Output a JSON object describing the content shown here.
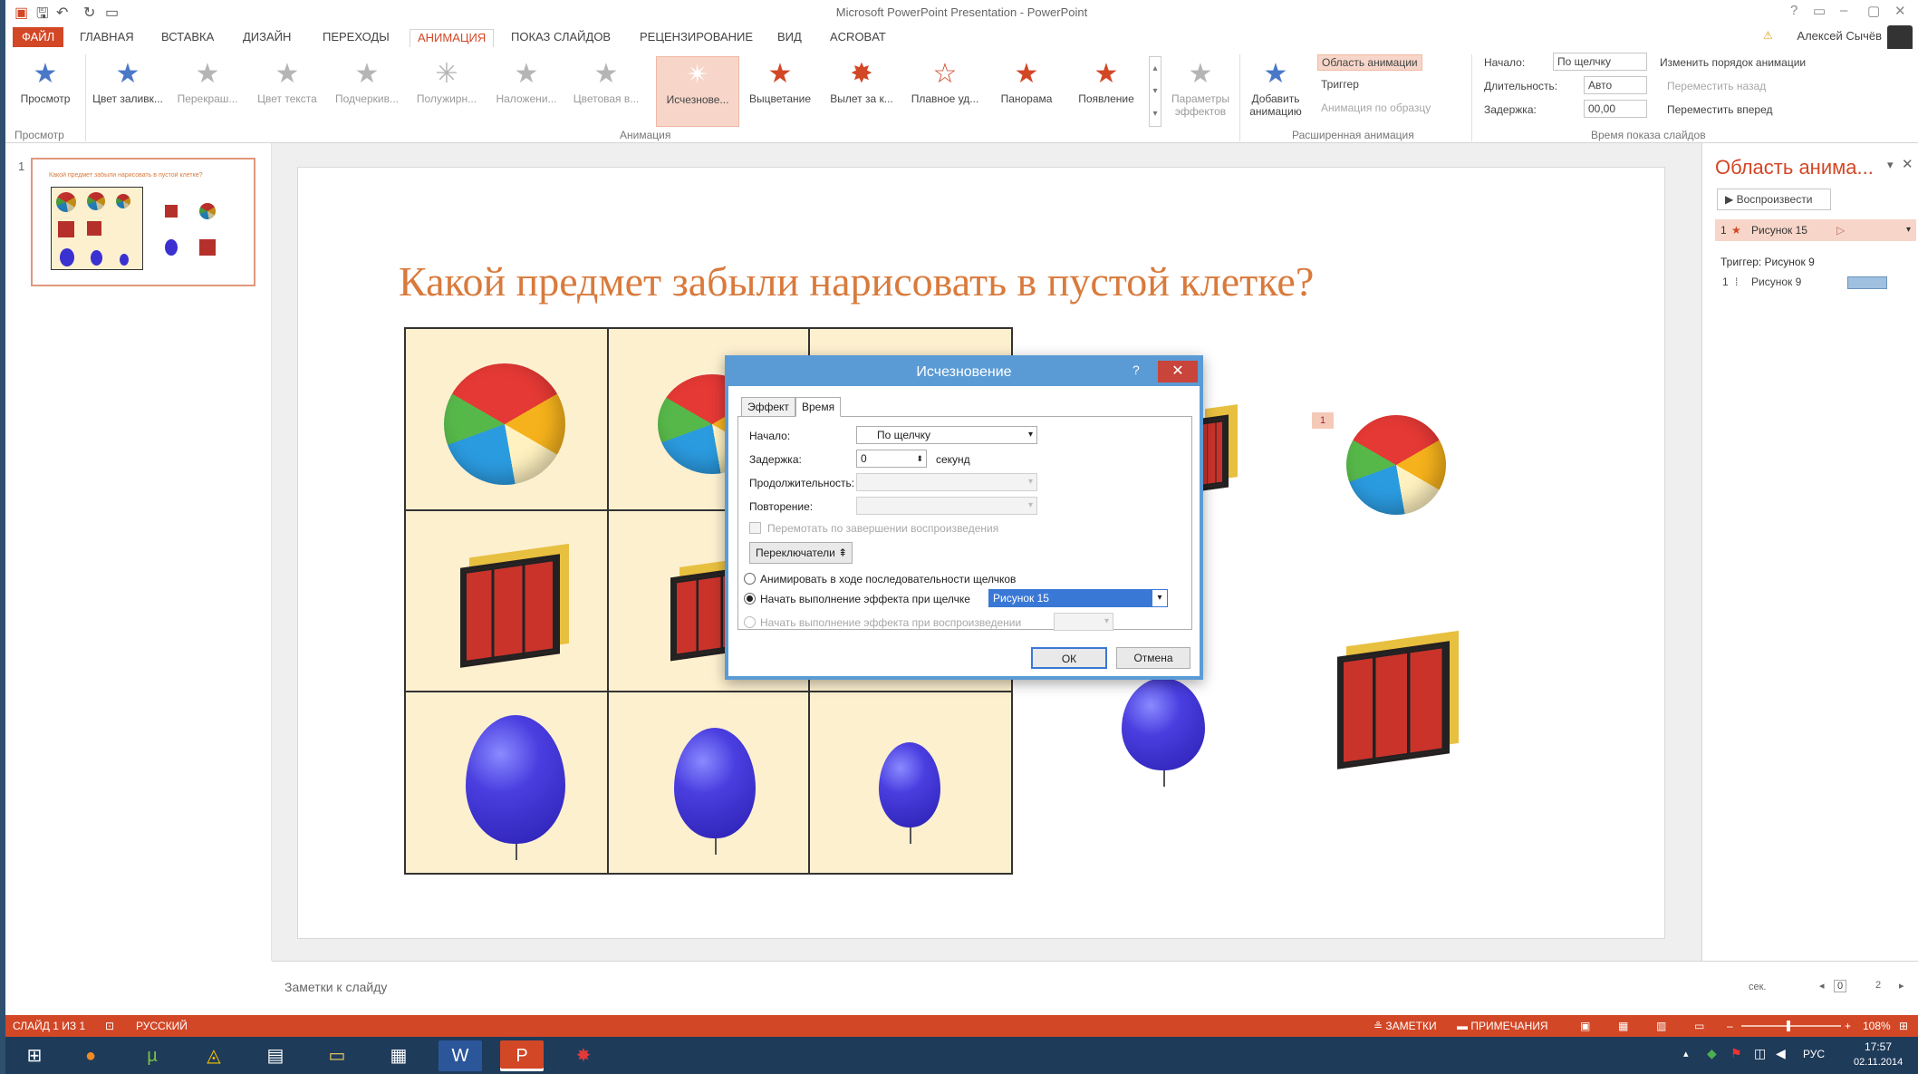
{
  "window": {
    "title": "Microsoft PowerPoint Presentation - PowerPoint",
    "user": "Алексей Сычёв",
    "help": "?"
  },
  "tabs": [
    "ФАЙЛ",
    "ГЛАВНАЯ",
    "ВСТАВКА",
    "ДИЗАЙН",
    "ПЕРЕХОДЫ",
    "АНИМАЦИЯ",
    "ПОКАЗ СЛАЙДОВ",
    "РЕЦЕНЗИРОВАНИЕ",
    "ВИД",
    "ACROBAT"
  ],
  "ribbon": {
    "preview": {
      "label": "Просмотр",
      "group": "Просмотр"
    },
    "animations": [
      "Цвет заливк...",
      "Перекраш...",
      "Цвет текста",
      "Подчеркив...",
      "Полужирн...",
      "Наложени...",
      "Цветовая в...",
      "Исчезнове...",
      "Выцветание",
      "Вылет за к...",
      "Плавное уд...",
      "Панорама",
      "Появление"
    ],
    "effect_options": "Параметры эффектов",
    "animation_group": "Анимация",
    "add_animation": "Добавить анимацию",
    "anim_pane": "Область анимации",
    "trigger": "Триггер",
    "painter": "Анимация по образцу",
    "advanced_group": "Расширенная анимация",
    "start_label": "Начало:",
    "start_value": "По щелчку",
    "duration_label": "Длительность:",
    "duration_value": "Авто",
    "delay_label": "Задержка:",
    "delay_value": "00,00",
    "reorder": "Изменить порядок анимации",
    "move_earlier": "Переместить назад",
    "move_later": "Переместить вперед",
    "timing_group": "Время показа слайдов"
  },
  "thumbnail": {
    "number": "1",
    "title": "Какой предмет забыли нарисовать в пустой клетке?"
  },
  "slide": {
    "title": "Какой предмет забыли нарисовать в пустой клетке?",
    "marker": "1"
  },
  "dialog": {
    "title": "Исчезновение",
    "tabs": [
      "Эффект",
      "Время"
    ],
    "start_label": "Начало:",
    "start_value": "По щелчку",
    "delay_label": "Задержка:",
    "delay_value": "0",
    "delay_unit": "секунд",
    "duration_label": "Продолжительность:",
    "repeat_label": "Повторение:",
    "rewind": "Перемотать по завершении воспроизведения",
    "triggers_btn": "Переключатели",
    "opt_sequence": "Анимировать в ходе последовательности щелчков",
    "opt_click": "Начать выполнение эффекта при щелчке",
    "click_target": "Рисунок 15",
    "opt_play": "Начать выполнение эффекта при воспроизведении",
    "ok": "ОК",
    "cancel": "Отмена"
  },
  "anim_pane": {
    "title": "Область анима...",
    "play": "Воспроизвести",
    "item1_num": "1",
    "item1": "Рисунок 15",
    "trigger_heading": "Триггер: Рисунок 9",
    "item2_num": "1",
    "item2": "Рисунок 9",
    "footer_sec": "сек.",
    "footer_0": "0",
    "footer_2": "2"
  },
  "notes": {
    "placeholder": "Заметки к слайду"
  },
  "status": {
    "slide": "СЛАЙД 1 ИЗ 1",
    "lang": "РУССКИЙ",
    "notes": "ЗАМЕТКИ",
    "comments": "ПРИМЕЧАНИЯ",
    "zoom": "108%"
  },
  "taskbar": {
    "lang": "РУС",
    "time": "17:57",
    "date": "02.11.2014"
  }
}
